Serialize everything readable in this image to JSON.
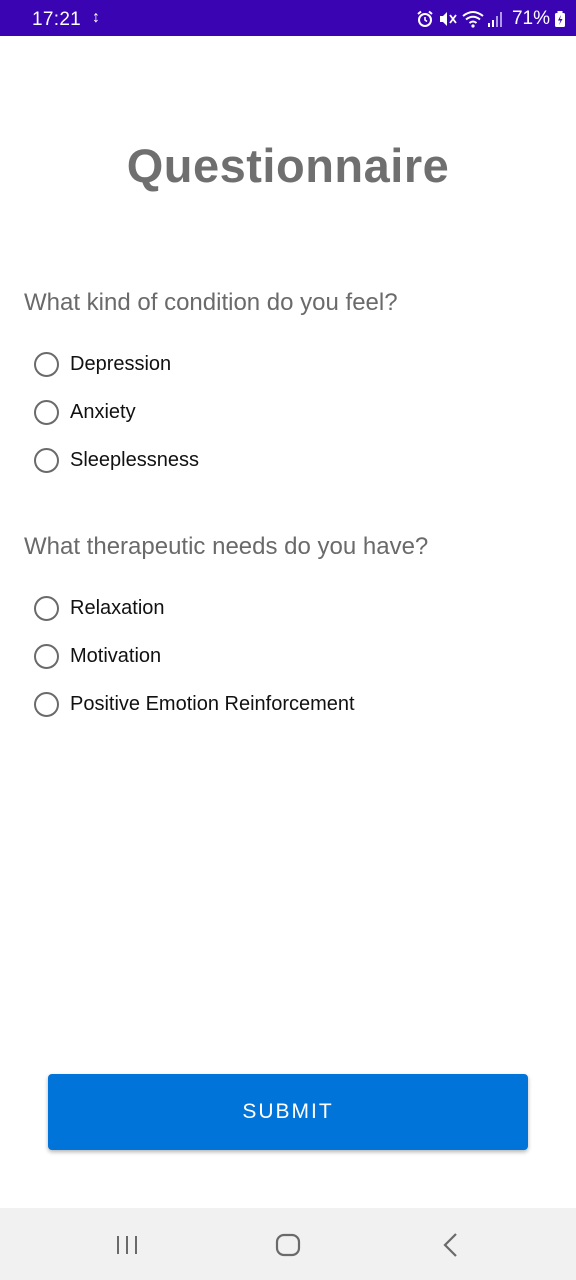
{
  "status_bar": {
    "time": "17:21",
    "sync_glyph": "↕",
    "battery_percent": "71%",
    "icons": [
      "alarm-icon",
      "mute-icon",
      "wifi-icon",
      "signal-icon",
      "battery-icon"
    ],
    "background": "#3a04b3"
  },
  "page": {
    "title": "Questionnaire"
  },
  "questions": [
    {
      "text": "What kind of condition do you feel?",
      "options": [
        "Depression",
        "Anxiety",
        "Sleeplessness"
      ]
    },
    {
      "text": "What therapeutic needs do you have?",
      "options": [
        "Relaxation",
        "Motivation",
        "Positive Emotion Reinforcement"
      ]
    }
  ],
  "submit_button": {
    "label": "SUBMIT",
    "color": "#0074d9"
  },
  "nav_bar": {
    "icons": [
      "recent-apps-icon",
      "home-icon",
      "back-icon"
    ]
  }
}
